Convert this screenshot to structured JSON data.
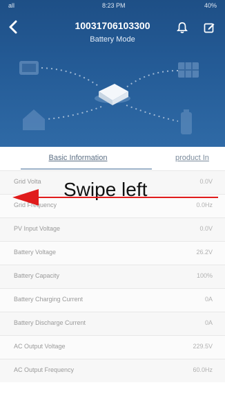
{
  "status_bar": {
    "carrier": "all",
    "time": "8:23 PM",
    "battery": "40%"
  },
  "header": {
    "back_icon": "chevron-left-icon",
    "title": "10031706103300",
    "subtitle": "Battery Mode",
    "bell_icon": "bell-icon",
    "edit_icon": "edit-icon"
  },
  "tabs": [
    "Basic Information",
    "product In"
  ],
  "rows": [
    {
      "label": "Grid Volta",
      "value": "0.0V"
    },
    {
      "label": "Grid Frequency",
      "value": "0.0Hz"
    },
    {
      "label": "PV Input Voltage",
      "value": "0.0V"
    },
    {
      "label": "Battery Voltage",
      "value": "26.2V"
    },
    {
      "label": "Battery Capacity",
      "value": "100%"
    },
    {
      "label": "Battery Charging Current",
      "value": "0A"
    },
    {
      "label": "Battery Discharge Current",
      "value": "0A"
    },
    {
      "label": "AC Output Voltage",
      "value": "229.5V"
    },
    {
      "label": "AC Output Frequency",
      "value": "60.0Hz"
    }
  ],
  "overlay": {
    "instruction": "Swipe left",
    "arrow_color": "#e01b1b"
  }
}
